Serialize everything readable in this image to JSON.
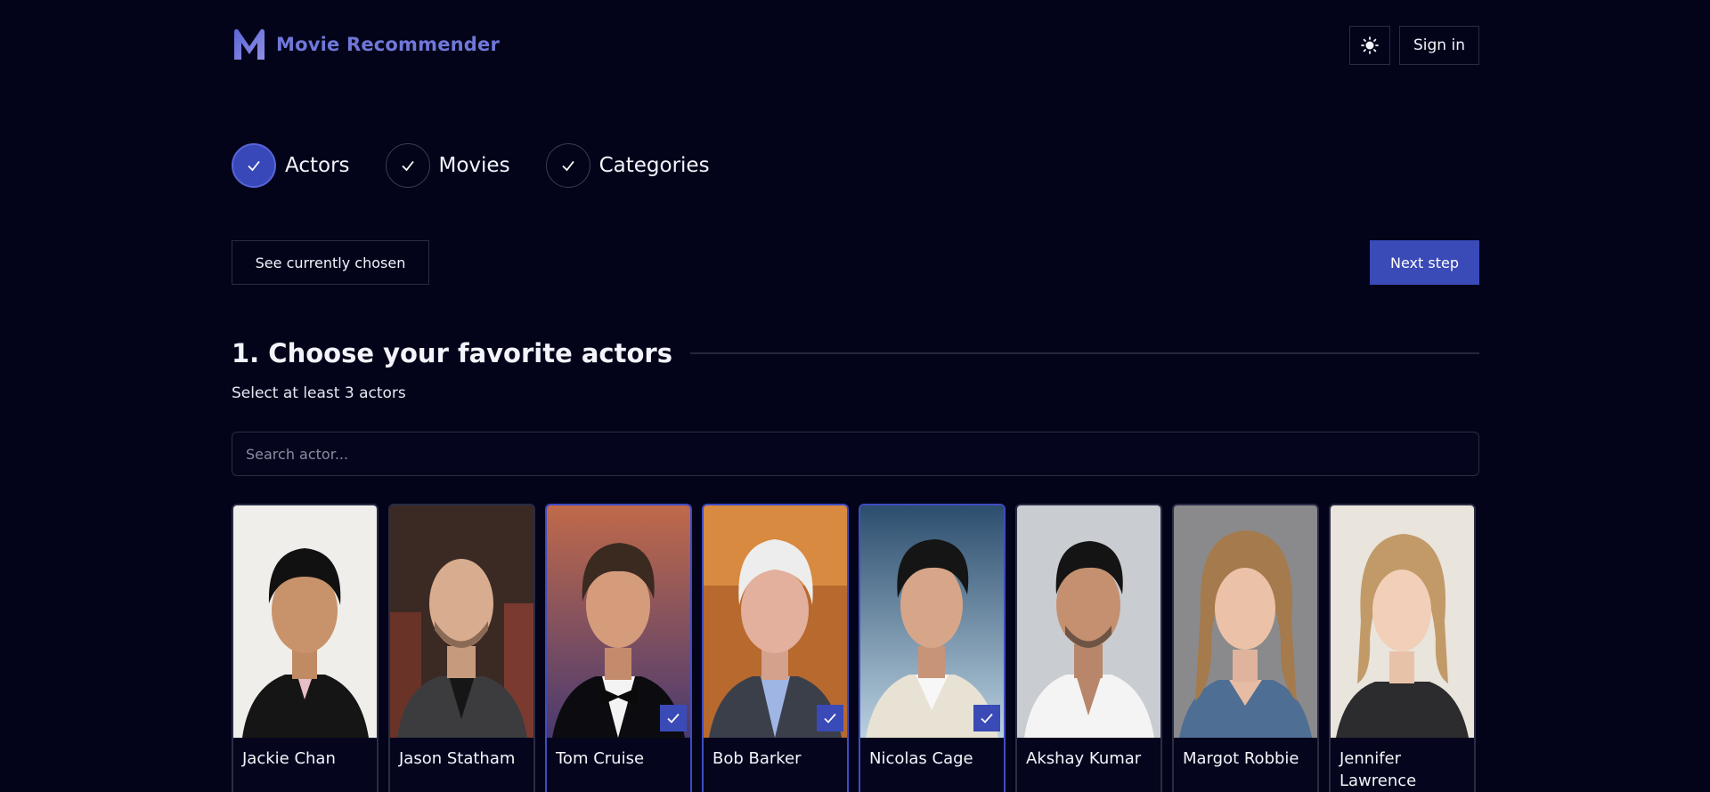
{
  "app": {
    "title": "Movie Recommender"
  },
  "header": {
    "signin_label": "Sign in",
    "theme_icon": "sun-icon"
  },
  "steps": [
    {
      "label": "Actors",
      "active": true
    },
    {
      "label": "Movies",
      "active": false
    },
    {
      "label": "Categories",
      "active": false
    }
  ],
  "actions": {
    "chosen_label": "See currently chosen",
    "next_label": "Next step"
  },
  "section": {
    "title": "1. Choose your favorite actors",
    "subtitle": "Select at least 3 actors"
  },
  "search": {
    "placeholder": "Search actor...",
    "value": ""
  },
  "actors": [
    {
      "name": "Jackie Chan",
      "selected": false
    },
    {
      "name": "Jason Statham",
      "selected": false
    },
    {
      "name": "Tom Cruise",
      "selected": true
    },
    {
      "name": "Bob Barker",
      "selected": true
    },
    {
      "name": "Nicolas Cage",
      "selected": true
    },
    {
      "name": "Akshay Kumar",
      "selected": false
    },
    {
      "name": "Margot Robbie",
      "selected": false
    },
    {
      "name": "Jennifer Lawrence",
      "selected": false
    }
  ],
  "colors": {
    "background": "#03041a",
    "accent": "#3a4ab7",
    "brand": "#6f78d8",
    "border": "#2a2c45"
  }
}
